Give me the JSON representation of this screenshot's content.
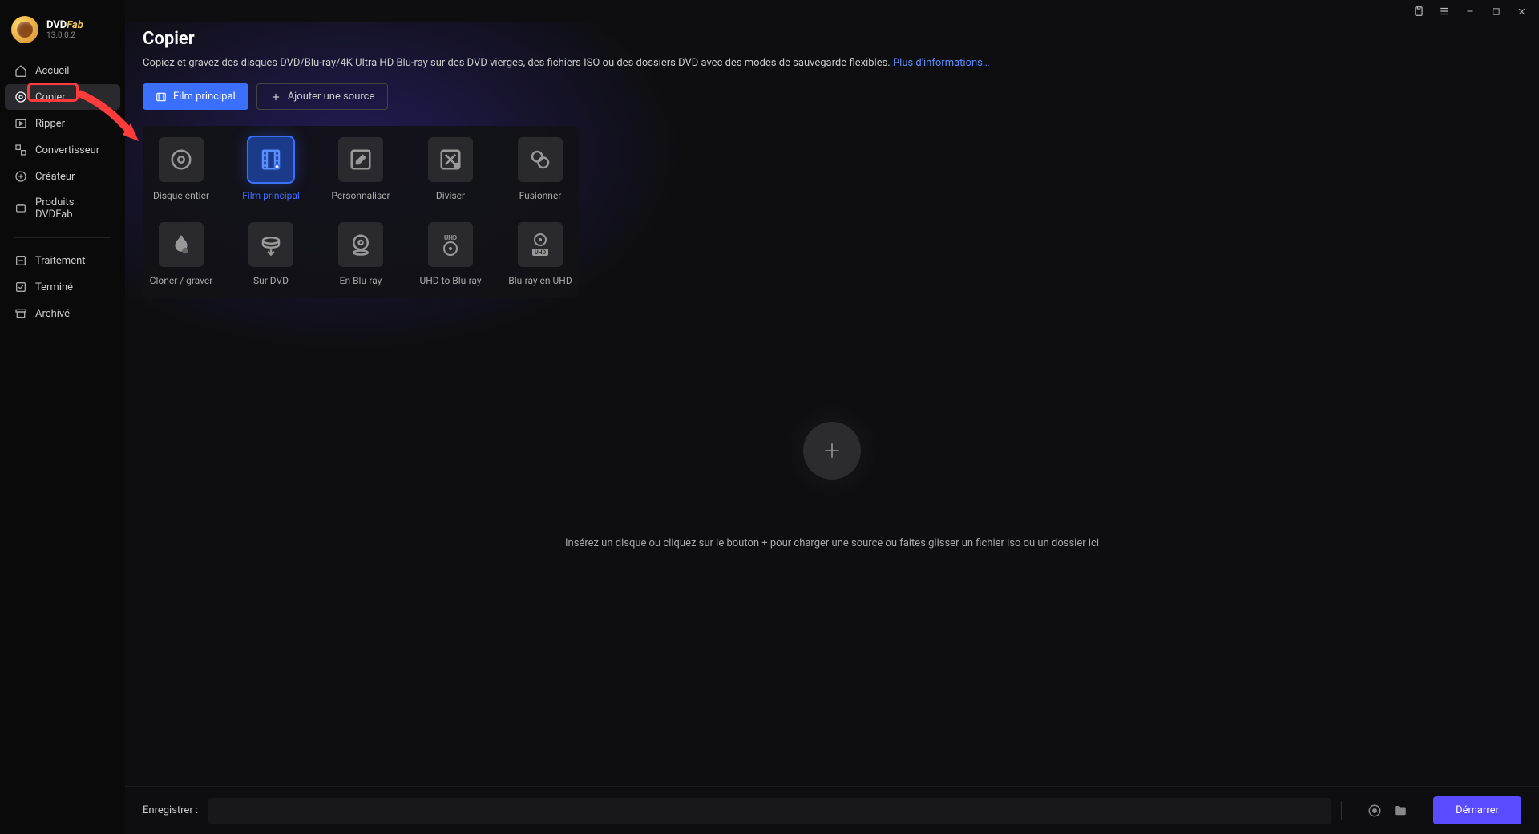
{
  "brand": {
    "name_part1": "DVD",
    "name_part2": "Fab",
    "version": "13.0.0.2"
  },
  "sidebar": {
    "items": [
      {
        "label": "Accueil"
      },
      {
        "label": "Copier"
      },
      {
        "label": "Ripper"
      },
      {
        "label": "Convertisseur"
      },
      {
        "label": "Créateur"
      },
      {
        "label": "Produits DVDFab"
      }
    ],
    "items2": [
      {
        "label": "Traitement"
      },
      {
        "label": "Terminé"
      },
      {
        "label": "Archivé"
      }
    ]
  },
  "page": {
    "title": "Copier",
    "description": "Copiez et gravez des disques DVD/Blu-ray/4K Ultra HD Blu-ray sur des DVD vierges, des fichiers ISO ou des dossiers DVD avec des modes de sauvegarde flexibles. ",
    "more_link": "Plus d'informations…"
  },
  "actions": {
    "primary": "Film principal",
    "secondary": "Ajouter une source"
  },
  "modes": {
    "row1": [
      {
        "label": "Disque entier"
      },
      {
        "label": "Film principal"
      },
      {
        "label": "Personnaliser"
      },
      {
        "label": "Diviser"
      },
      {
        "label": "Fusionner"
      }
    ],
    "row2": [
      {
        "label": "Cloner / graver"
      },
      {
        "label": "Sur DVD"
      },
      {
        "label": "En Blu-ray"
      },
      {
        "label": "UHD to Blu-ray"
      },
      {
        "label": "Blu-ray en UHD"
      }
    ]
  },
  "drop": {
    "text": "Insérez un disque ou cliquez sur le bouton +  pour charger une source ou faites glisser un fichier iso ou un dossier ici"
  },
  "footer": {
    "label": "Enregistrer :",
    "start": "Démarrer"
  }
}
